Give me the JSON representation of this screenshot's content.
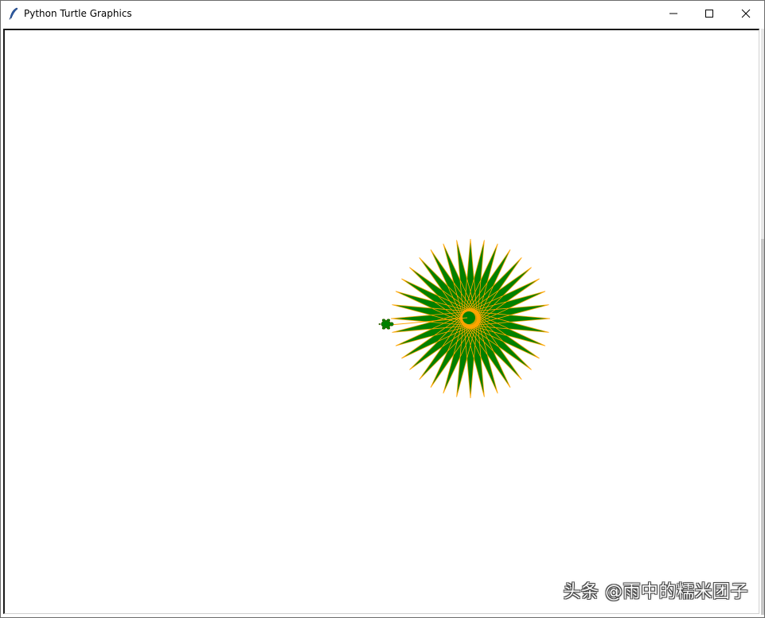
{
  "window": {
    "title": "Python Turtle Graphics",
    "app_icon": "feather-icon",
    "controls": {
      "minimize_icon": "minimize-icon",
      "maximize_icon": "maximize-icon",
      "close_icon": "close-icon"
    }
  },
  "drawing": {
    "shape": "star-burst",
    "star_points": 36,
    "fill_color": "#008000",
    "pen_color": "#ffa500",
    "turtle_color": "#008000",
    "turtle_icon": "turtle-icon"
  },
  "watermark": {
    "text": "头条 @雨中的糯米团子"
  }
}
